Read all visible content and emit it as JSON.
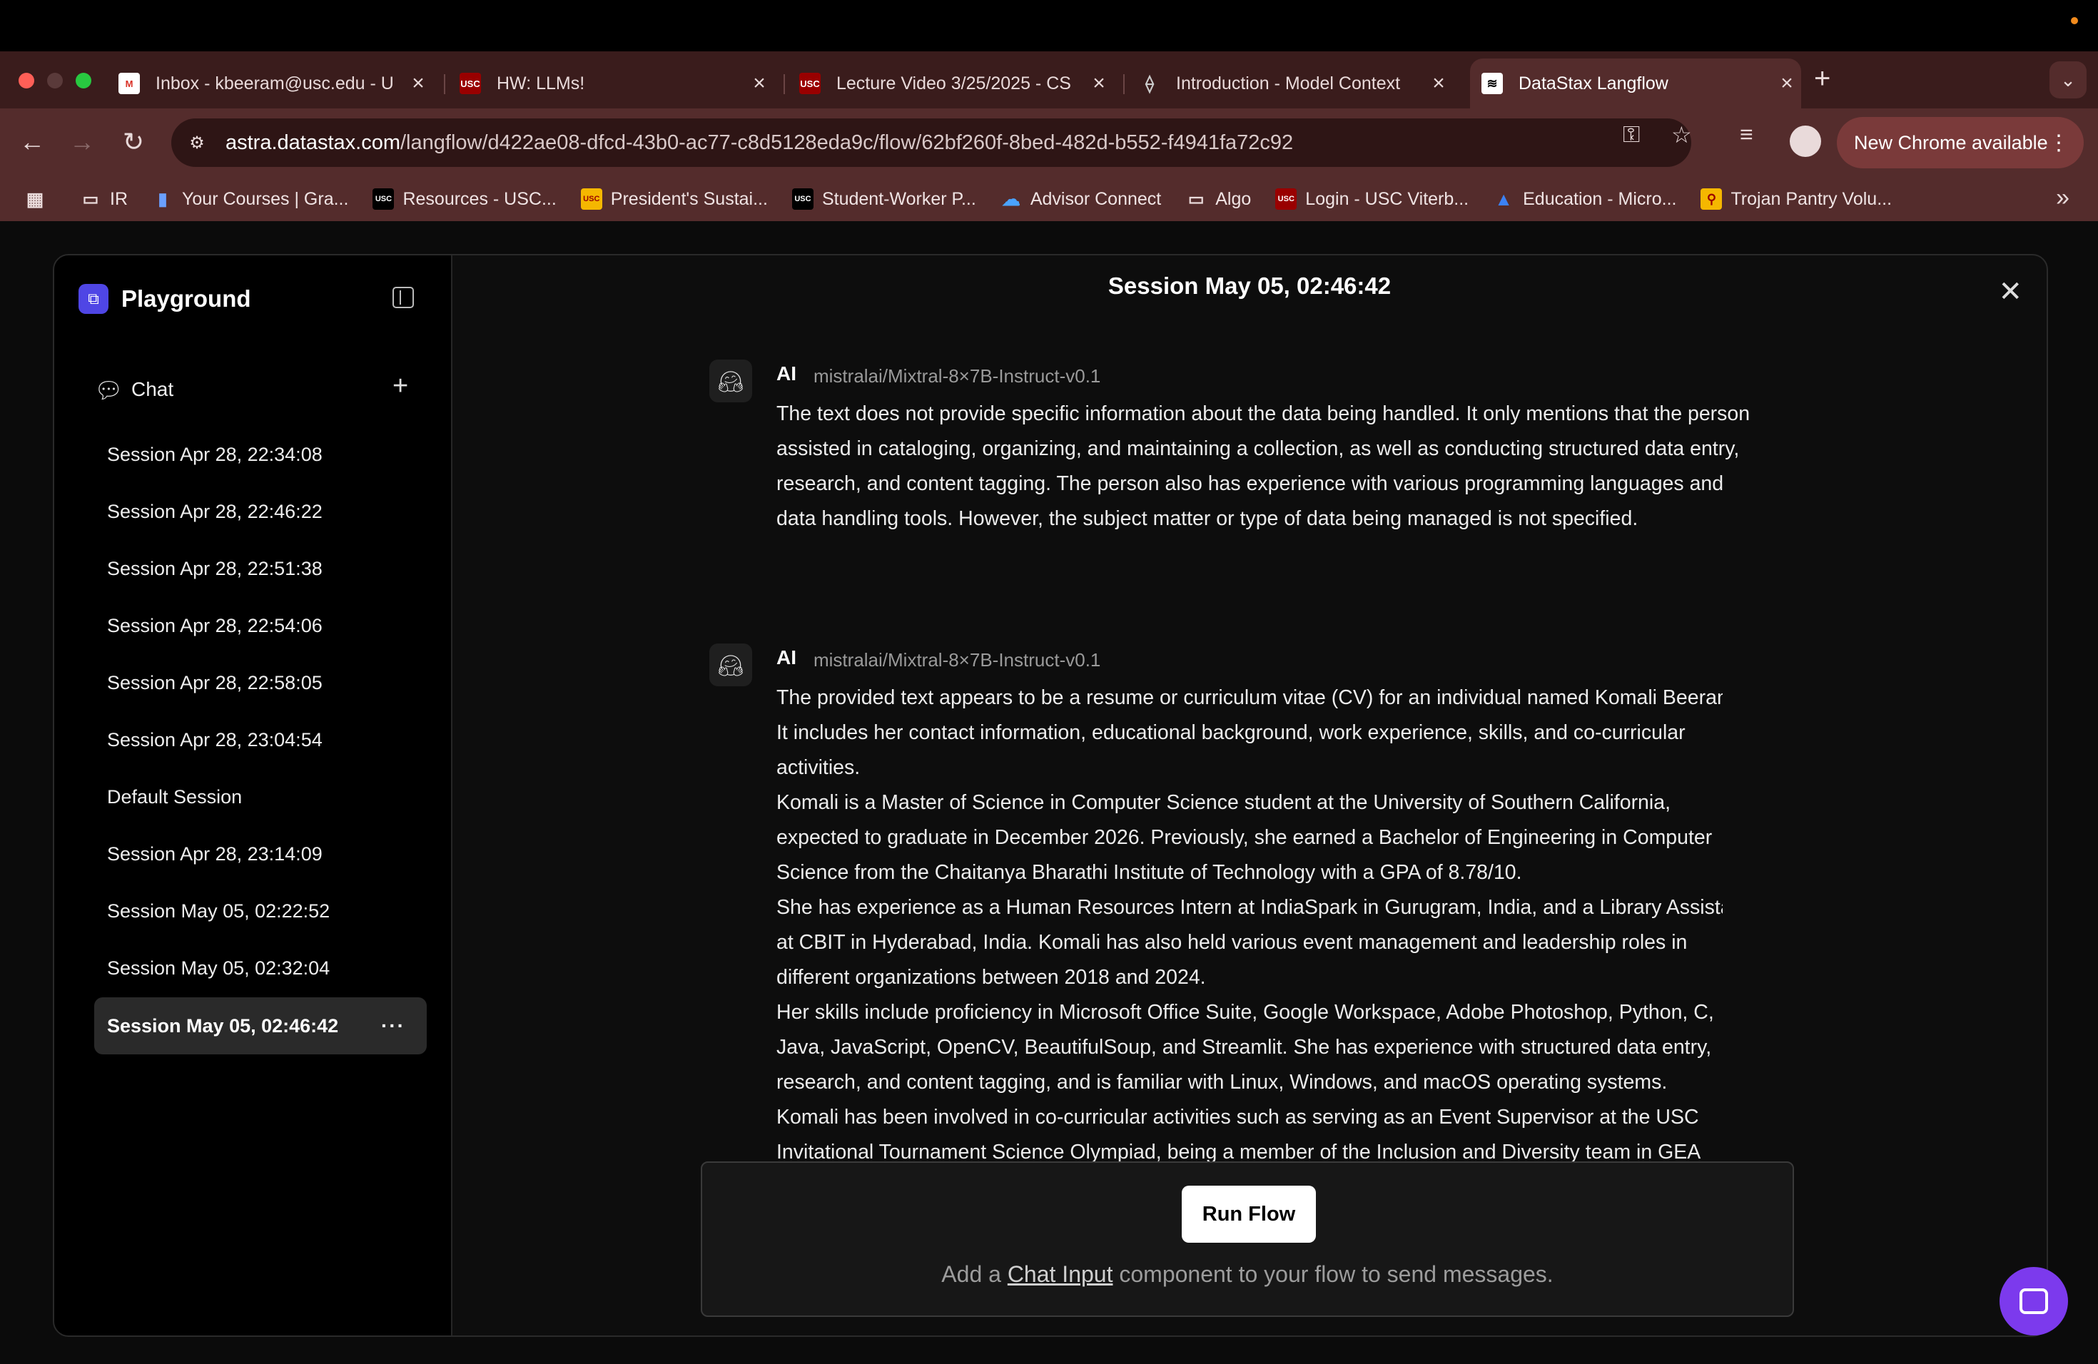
{
  "browser": {
    "tabs": [
      {
        "title": "Inbox - kbeeram@usc.edu - U",
        "favicon": "gmail-icon"
      },
      {
        "title": "HW: LLMs!",
        "favicon": "usc-icon"
      },
      {
        "title": "Lecture Video 3/25/2025 - CS",
        "favicon": "usc-icon"
      },
      {
        "title": "Introduction - Model Context",
        "favicon": "mcp-icon"
      },
      {
        "title": "DataStax Langflow",
        "favicon": "langflow-icon"
      }
    ],
    "url_host": "astra.datastax.com",
    "url_path": "/langflow/d422ae08-dfcd-43b0-ac77-c8d5128eda9c/flow/62bf260f-8bed-482d-b552-f4941fa72c92",
    "update_label": "New Chrome available",
    "bookmarks": [
      "IR",
      "Your Courses | Gra...",
      "Resources - USC...",
      "President's Sustai...",
      "Student-Worker P...",
      "Advisor Connect",
      "Algo",
      "Login - USC Viterb...",
      "Education - Micro...",
      "Trojan Pantry Volu..."
    ],
    "accent": "#542c2c"
  },
  "playground": {
    "title": "Playground",
    "chat_label": "Chat",
    "sessions": [
      "Session Apr 28, 22:34:08",
      "Session Apr 28, 22:46:22",
      "Session Apr 28, 22:51:38",
      "Session Apr 28, 22:54:06",
      "Session Apr 28, 22:58:05",
      "Session Apr 28, 23:04:54",
      "Default Session",
      "Session Apr 28, 23:14:09",
      "Session May 05, 02:22:52",
      "Session May 05, 02:32:04",
      "Session May 05, 02:46:42"
    ],
    "active_session": "Session May 05, 02:46:42",
    "session_title": "Session May 05, 02:46:42"
  },
  "messages": [
    {
      "sender": "AI",
      "model": "mistralai/Mixtral-8×7B-Instruct-v0.1",
      "paragraphs": [
        "The text does not provide specific information about the data being handled. It only mentions that the person assisted in cataloging, organizing, and maintaining a collection, as well as conducting structured data entry, research, and content tagging. The person also has experience with various programming languages and data handling tools. However, the subject matter or type of data being managed is not specified."
      ]
    },
    {
      "sender": "AI",
      "model": "mistralai/Mixtral-8×7B-Instruct-v0.1",
      "paragraphs": [
        "The provided text appears to be a resume or curriculum vitae (CV) for an individual named Komali Beeram. It includes her contact information, educational background, work experience, skills, and co-curricular activities.",
        "Komali is a Master of Science in Computer Science student at the University of Southern California, expected to graduate in December 2026. Previously, she earned a Bachelor of Engineering in Computer Science from the Chaitanya Bharathi Institute of Technology with a GPA of 8.78/10.",
        "She has experience as a Human Resources Intern at IndiaSpark in Gurugram, India, and a Library Assistant at CBIT in Hyderabad, India. Komali has also held various event management and leadership roles in different organizations between 2018 and 2024.",
        "Her skills include proficiency in Microsoft Office Suite, Google Workspace, Adobe Photoshop, Python, C, Java, JavaScript, OpenCV, BeautifulSoup, and Streamlit. She has experience with structured data entry, research, and content tagging, and is familiar with Linux, Windows, and macOS operating systems.",
        "Komali has been involved in co-curricular activities such as serving as an Event Supervisor at the USC Invitational Tournament Science Olympiad, being a member of the Inclusion and Diversity team in GEA"
      ]
    }
  ],
  "input": {
    "run_label": "Run Flow",
    "hint_prefix": "Add a ",
    "hint_link": "Chat Input",
    "hint_suffix": " component to your flow to send messages."
  }
}
